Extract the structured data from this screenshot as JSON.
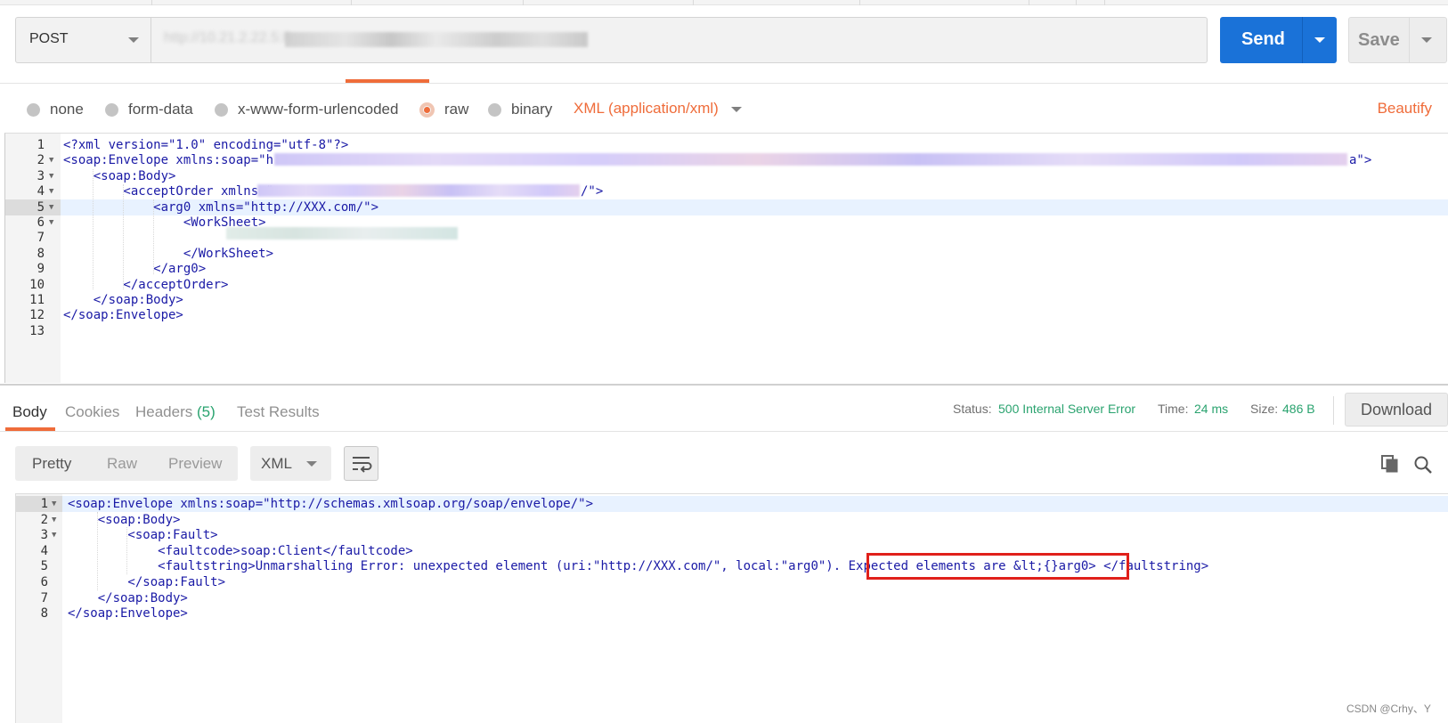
{
  "request": {
    "method": "POST",
    "url_visible": "http://10.21.2.22.5:8"
  },
  "buttons": {
    "send_label": "Send",
    "save_label": "Save",
    "beautify_label": "Beautify",
    "download_label": "Download"
  },
  "body_types": [
    {
      "label": "none",
      "selected": false
    },
    {
      "label": "form-data",
      "selected": false
    },
    {
      "label": "x-www-form-urlencoded",
      "selected": false
    },
    {
      "label": "raw",
      "selected": true
    },
    {
      "label": "binary",
      "selected": false
    }
  ],
  "raw_type": "XML (application/xml)",
  "request_lines": [
    {
      "n": "1",
      "text": "<?xml version=\"1.0\" encoding=\"utf-8\"?>"
    },
    {
      "n": "2",
      "text": "<soap:Envelope xmlns:soap=\"h",
      "tail": "a\">"
    },
    {
      "n": "3",
      "text": "    <soap:Body>"
    },
    {
      "n": "4",
      "text": "        <acceptOrder xmlns=\"",
      "tail": "/\">"
    },
    {
      "n": "5",
      "text": "            <arg0 xmlns=\"http://XXX.com/\">"
    },
    {
      "n": "6",
      "text": "                <WorkSheet>"
    },
    {
      "n": "7",
      "text": ""
    },
    {
      "n": "8",
      "text": "                </WorkSheet>"
    },
    {
      "n": "9",
      "text": "            </arg0>"
    },
    {
      "n": "10",
      "text": "        </acceptOrder>"
    },
    {
      "n": "11",
      "text": "    </soap:Body>"
    },
    {
      "n": "12",
      "text": "</soap:Envelope>"
    },
    {
      "n": "13",
      "text": ""
    }
  ],
  "response_tabs": [
    {
      "label": "Body",
      "active": true
    },
    {
      "label": "Cookies",
      "active": false
    },
    {
      "label": "Headers",
      "active": false,
      "count": "(5)"
    },
    {
      "label": "Test Results",
      "active": false
    }
  ],
  "status": {
    "status_label": "Status:",
    "status_value": "500 Internal Server Error",
    "time_label": "Time:",
    "time_value": "24 ms",
    "size_label": "Size:",
    "size_value": "486 B"
  },
  "view_modes": [
    {
      "label": "Pretty",
      "active": true
    },
    {
      "label": "Raw",
      "active": false
    },
    {
      "label": "Preview",
      "active": false
    }
  ],
  "response_language": "XML",
  "response_lines": [
    {
      "n": "1",
      "text": "<soap:Envelope xmlns:soap=\"http://schemas.xmlsoap.org/soap/envelope/\">"
    },
    {
      "n": "2",
      "text": "    <soap:Body>"
    },
    {
      "n": "3",
      "text": "        <soap:Fault>"
    },
    {
      "n": "4",
      "text": "            <faultcode>soap:Client</faultcode>"
    },
    {
      "n": "5",
      "text": "            <faultstring>Unmarshalling Error: unexpected element (uri:\"http://XXX.com/\", local:\"arg0\"). Expected elements are &lt;{}arg0> </faultstring>"
    },
    {
      "n": "6",
      "text": "        </soap:Fault>"
    },
    {
      "n": "7",
      "text": "    </soap:Body>"
    },
    {
      "n": "8",
      "text": "</soap:Envelope>"
    }
  ],
  "watermark": "CSDN @Crhy、Y",
  "colors": {
    "accent_orange": "#ef6c3a",
    "send_blue": "#1a72d8",
    "status_green": "#2aa36f",
    "highlight_red": "#e0201a",
    "xml_blue": "#1a1aa6"
  }
}
